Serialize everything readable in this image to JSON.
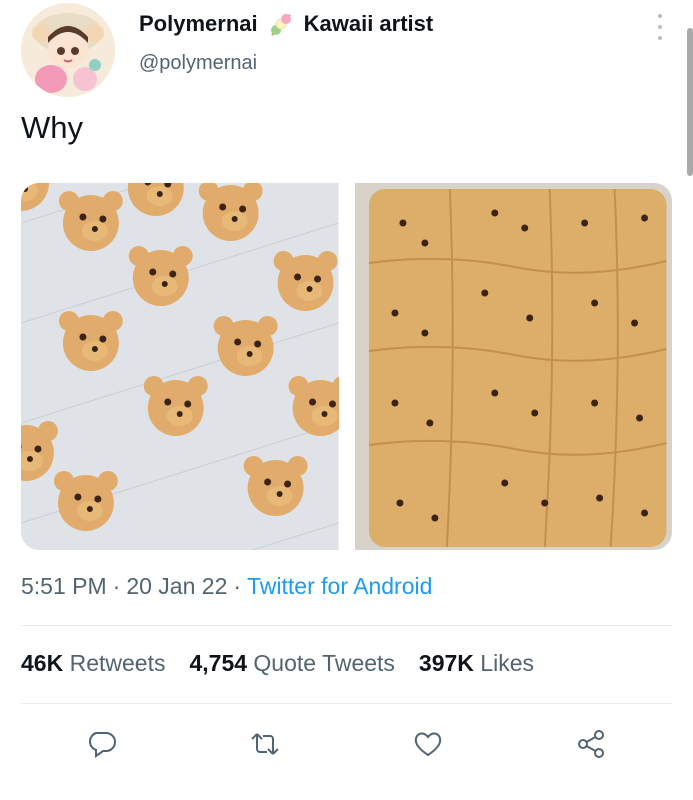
{
  "user": {
    "display_name": "Polymernai",
    "display_suffix": "Kawaii artist",
    "handle": "@polymernai",
    "emoji_icon": "dango-icon",
    "verified": false
  },
  "tweet": {
    "text": "Why",
    "time": "5:51 PM",
    "separator": "·",
    "date": "20 Jan 22",
    "source": "Twitter for Android"
  },
  "stats": {
    "retweets_count": "46K",
    "retweets_label": "Retweets",
    "quotes_count": "4,754",
    "quotes_label": "Quote Tweets",
    "likes_count": "397K",
    "likes_label": "Likes"
  },
  "actions": [
    {
      "name": "reply",
      "icon": "reply-icon"
    },
    {
      "name": "retweet",
      "icon": "retweet-icon"
    },
    {
      "name": "like",
      "icon": "heart-icon"
    },
    {
      "name": "share",
      "icon": "share-icon"
    }
  ],
  "colors": {
    "link": "#1d9bf0",
    "muted": "#536471",
    "text": "#0f1419"
  }
}
